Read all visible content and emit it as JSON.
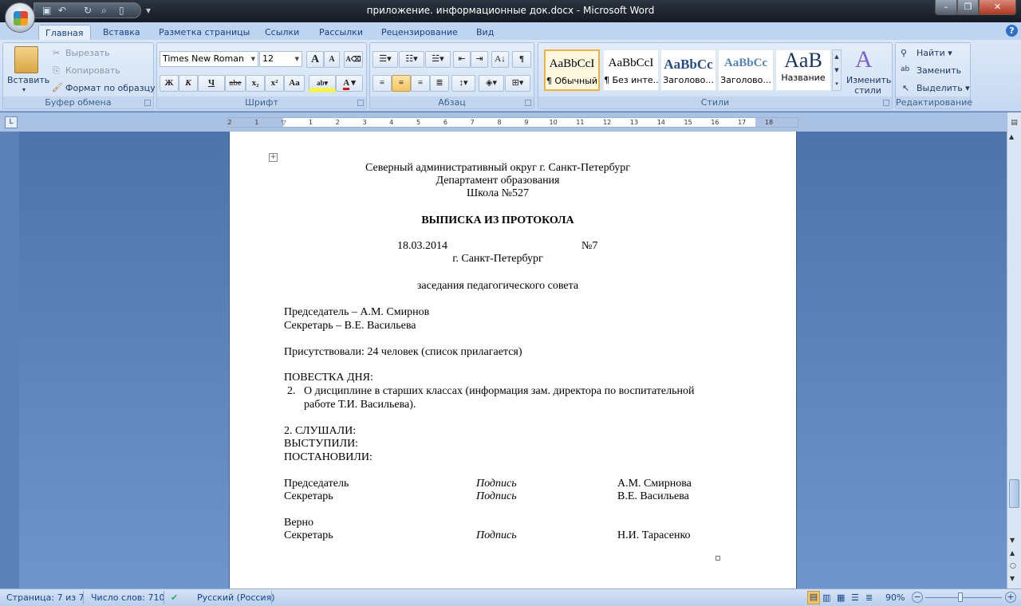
{
  "window": {
    "title": "приложение. информационные док.docx - Microsoft Word",
    "minimize": "–",
    "restore": "❐",
    "close": "✕"
  },
  "tabs": [
    "Главная",
    "Вставка",
    "Разметка страницы",
    "Ссылки",
    "Рассылки",
    "Рецензирование",
    "Вид"
  ],
  "clipboard": {
    "paste": "Вставить",
    "cut": "Вырезать",
    "copy": "Копировать",
    "format_painter": "Формат по образцу",
    "label": "Буфер обмена"
  },
  "font": {
    "name": "Times New Roman",
    "size": "12",
    "bold": "Ж",
    "italic": "К",
    "underline": "Ч",
    "strike": "abe",
    "sub": "x₂",
    "sup": "x²",
    "case": "Aa",
    "grow": "A",
    "shrink": "A",
    "label": "Шрифт",
    "font_color": "#e01010"
  },
  "paragraph": {
    "label": "Абзац",
    "active_align": "center"
  },
  "styles": {
    "label": "Стили",
    "items": [
      {
        "preview": "AaBbCcI",
        "name": "¶ Обычный",
        "selected": true
      },
      {
        "preview": "AaBbCcI",
        "name": "¶ Без инте..."
      },
      {
        "preview": "AaBbCc",
        "name": "Заголово..."
      },
      {
        "preview": "AaBbCc",
        "name": "Заголово..."
      },
      {
        "preview": "AaB",
        "name": "Название"
      }
    ],
    "change": "Изменить стили"
  },
  "editing": {
    "label": "Редактирование",
    "find": "Найти",
    "replace": "Заменить",
    "select": "Выделить"
  },
  "ruler": {
    "ticks": [
      "2",
      "1",
      "",
      "1",
      "2",
      "3",
      "4",
      "5",
      "6",
      "7",
      "8",
      "9",
      "10",
      "11",
      "12",
      "13",
      "14",
      "15",
      "16",
      "17",
      "18"
    ]
  },
  "document": {
    "header": [
      "Северный административный округ г. Санкт-Петербург",
      "Департамент образования",
      "Школа №527"
    ],
    "title": "ВЫПИСКА ИЗ ПРОТОКОЛА",
    "date": "18.03.2014",
    "number": "№7",
    "city": "г. Санкт-Петербург",
    "meeting": "заседания педагогического  совета",
    "chair": "Председатель  – А.М. Смирнов",
    "secretary": "Секретарь – В.Е. Васильева",
    "present": "Присутствовали: 24 человек  (список прилагается)",
    "agenda_title": "ПОВЕСТКА  ДНЯ:",
    "agenda_num": "2.",
    "agenda_line1": "О дисциплине в старших  классах (информация зам. директора по воспитательной",
    "agenda_line2": "работе Т.И. Васильева).",
    "heard": "2. СЛУШАЛИ:",
    "spoke": "ВЫСТУПИЛИ:",
    "resolved": "ПОСТАНОВИЛИ:",
    "signatures": [
      {
        "role": "Председатель",
        "sign": "Подпись",
        "name": "А.М. Смирнова"
      },
      {
        "role": "Секретарь",
        "sign": "Подпись",
        "name": "В.Е. Васильева"
      }
    ],
    "verified": "Верно",
    "final_signature": {
      "role": "Секретарь",
      "sign": "Подпись",
      "name": "Н.И. Тарасенко"
    }
  },
  "status": {
    "page": "Страница: 7 из 7",
    "words": "Число слов: 710",
    "language": "Русский (Россия)",
    "zoom": "90%",
    "zoom_percent": 90
  }
}
